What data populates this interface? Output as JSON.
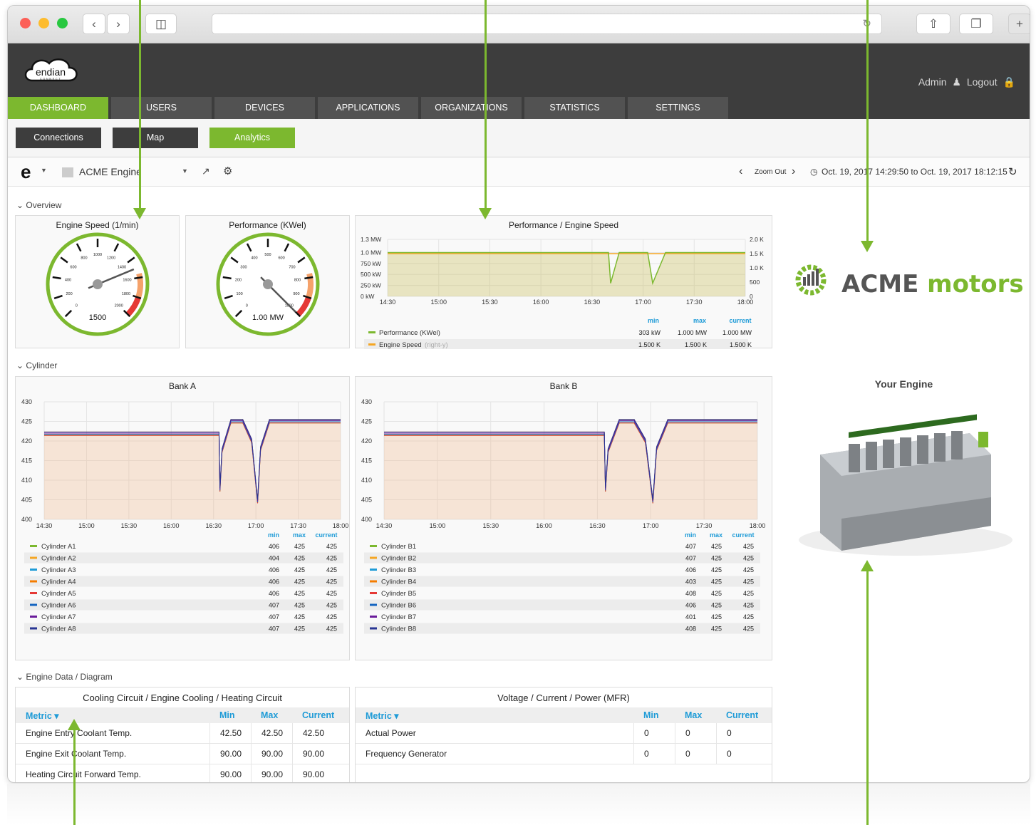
{
  "header": {
    "user": "Admin",
    "logout": "Logout"
  },
  "nav": [
    "DASHBOARD",
    "USERS",
    "DEVICES",
    "APPLICATIONS",
    "ORGANIZATIONS",
    "STATISTICS",
    "SETTINGS"
  ],
  "subnav": [
    "Connections",
    "Map",
    "Analytics"
  ],
  "toolbar": {
    "dashboard": "ACME Engine",
    "zoom": "Zoom Out",
    "range": "Oct. 19, 2017 14:29:50 to Oct. 19, 2017 18:12:15"
  },
  "rows": {
    "overview": "Overview",
    "cylinder": "Cylinder",
    "engine": "Engine Data / Diagram"
  },
  "gauges": [
    {
      "title": "Engine Speed (1/min)",
      "value_label": "1500",
      "value": 1500,
      "max": 2000,
      "ticks": [
        "0",
        "200",
        "400",
        "600",
        "800",
        "1000",
        "1200",
        "1400",
        "1600",
        "1800",
        "2000"
      ]
    },
    {
      "title": "Performance (KWel)",
      "value_label": "1.00 MW",
      "value": 1000,
      "max": 1000,
      "ticks": [
        "0",
        "100",
        "200",
        "300",
        "400",
        "500",
        "600",
        "700",
        "800",
        "900",
        "1000"
      ]
    }
  ],
  "perf": {
    "title": "Performance / Engine Speed",
    "yleft": [
      "1.3 MW",
      "1.0 MW",
      "750 kW",
      "500 kW",
      "250 kW",
      "0 kW"
    ],
    "yright": [
      "2.0 K",
      "1.5 K",
      "1.0 K",
      "500",
      "0"
    ],
    "x": [
      "14:30",
      "15:00",
      "15:30",
      "16:00",
      "16:30",
      "17:00",
      "17:30",
      "18:00"
    ],
    "legend_head": [
      "min",
      "max",
      "current"
    ],
    "legend": [
      {
        "name": "Performance (KWel)",
        "note": "",
        "color": "#7cb82f",
        "vals": [
          "303 kW",
          "1.000 MW",
          "1.000 MW"
        ]
      },
      {
        "name": "Engine Speed",
        "note": "(right-y)",
        "color": "#f5a623",
        "vals": [
          "1.500 K",
          "1.500 K",
          "1.500 K"
        ]
      }
    ]
  },
  "chart_data": [
    {
      "type": "line",
      "title": "Bank A",
      "x": [
        "14:30",
        "15:00",
        "15:30",
        "16:00",
        "16:30",
        "17:00",
        "17:30",
        "18:00"
      ],
      "ylim": [
        400,
        430
      ],
      "yticks": [
        "430",
        "425",
        "420",
        "415",
        "410",
        "405",
        "400"
      ],
      "legend_head": [
        "min",
        "max",
        "current"
      ],
      "series": [
        {
          "name": "Cylinder A1",
          "color": "#7cb82f",
          "vals": [
            "406",
            "425",
            "425"
          ]
        },
        {
          "name": "Cylinder A2",
          "color": "#f5a623",
          "vals": [
            "404",
            "425",
            "425"
          ]
        },
        {
          "name": "Cylinder A3",
          "color": "#1e9bd7",
          "vals": [
            "406",
            "425",
            "425"
          ]
        },
        {
          "name": "Cylinder A4",
          "color": "#f57c00",
          "vals": [
            "406",
            "425",
            "425"
          ]
        },
        {
          "name": "Cylinder A5",
          "color": "#e53935",
          "vals": [
            "406",
            "425",
            "425"
          ]
        },
        {
          "name": "Cylinder A6",
          "color": "#1565c0",
          "vals": [
            "407",
            "425",
            "425"
          ]
        },
        {
          "name": "Cylinder A7",
          "color": "#6a1b9a",
          "vals": [
            "407",
            "425",
            "425"
          ]
        },
        {
          "name": "Cylinder A8",
          "color": "#283593",
          "vals": [
            "407",
            "425",
            "425"
          ]
        }
      ]
    },
    {
      "type": "line",
      "title": "Bank B",
      "x": [
        "14:30",
        "15:00",
        "15:30",
        "16:00",
        "16:30",
        "17:00",
        "17:30",
        "18:00"
      ],
      "ylim": [
        400,
        430
      ],
      "yticks": [
        "430",
        "425",
        "420",
        "415",
        "410",
        "405",
        "400"
      ],
      "legend_head": [
        "min",
        "max",
        "current"
      ],
      "series": [
        {
          "name": "Cylinder B1",
          "color": "#7cb82f",
          "vals": [
            "407",
            "425",
            "425"
          ]
        },
        {
          "name": "Cylinder B2",
          "color": "#f5a623",
          "vals": [
            "407",
            "425",
            "425"
          ]
        },
        {
          "name": "Cylinder B3",
          "color": "#1e9bd7",
          "vals": [
            "406",
            "425",
            "425"
          ]
        },
        {
          "name": "Cylinder B4",
          "color": "#f57c00",
          "vals": [
            "403",
            "425",
            "425"
          ]
        },
        {
          "name": "Cylinder B5",
          "color": "#e53935",
          "vals": [
            "408",
            "425",
            "425"
          ]
        },
        {
          "name": "Cylinder B6",
          "color": "#1565c0",
          "vals": [
            "406",
            "425",
            "425"
          ]
        },
        {
          "name": "Cylinder B7",
          "color": "#6a1b9a",
          "vals": [
            "401",
            "425",
            "425"
          ]
        },
        {
          "name": "Cylinder B8",
          "color": "#283593",
          "vals": [
            "408",
            "425",
            "425"
          ]
        }
      ]
    }
  ],
  "brand": {
    "acme": "ACME",
    "motors": "motors",
    "engine_title": "Your Engine"
  },
  "cooling": {
    "title": "Cooling Circuit / Engine Cooling / Heating Circuit",
    "head": [
      "Metric",
      "Min",
      "Max",
      "Current"
    ],
    "rows": [
      [
        "Engine Entry Coolant Temp.",
        "42.50",
        "42.50",
        "42.50"
      ],
      [
        "Engine Exit Coolant  Temp.",
        "90.00",
        "90.00",
        "90.00"
      ],
      [
        "Heating Circuit Forward Temp.",
        "90.00",
        "90.00",
        "90.00"
      ]
    ]
  },
  "power": {
    "title": "Voltage / Current / Power (MFR)",
    "head": [
      "Metric",
      "Min",
      "Max",
      "Current"
    ],
    "rows": [
      [
        "Actual Power",
        "0",
        "0",
        "0"
      ],
      [
        "Frequency Generator",
        "0",
        "0",
        "0"
      ]
    ]
  }
}
